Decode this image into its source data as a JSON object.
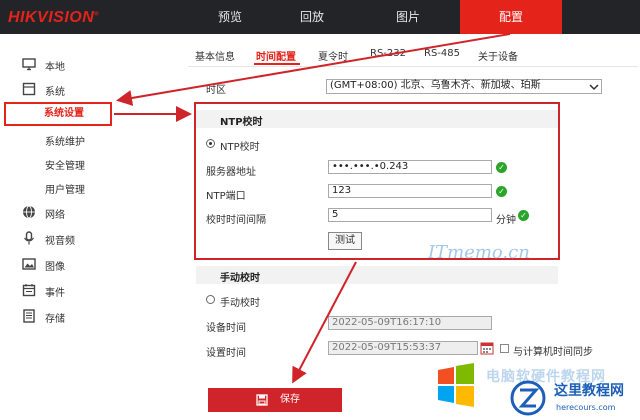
{
  "brand": {
    "logo": "HIKVISION",
    "reg": "®"
  },
  "topnav": [
    {
      "label": "预览"
    },
    {
      "label": "回放"
    },
    {
      "label": "图片"
    },
    {
      "label": "配置"
    }
  ],
  "sidebar": {
    "items": [
      {
        "label": "本地",
        "icon": "monitor-icon"
      },
      {
        "label": "系统",
        "icon": "system-icon"
      },
      {
        "label": "网络",
        "icon": "globe-icon"
      },
      {
        "label": "视音频",
        "icon": "microphone-icon"
      },
      {
        "label": "图像",
        "icon": "image-icon"
      },
      {
        "label": "事件",
        "icon": "calendar-icon"
      },
      {
        "label": "存储",
        "icon": "disk-icon"
      }
    ],
    "system_sub": [
      "系统设置",
      "系统维护",
      "安全管理",
      "用户管理"
    ]
  },
  "tabs": [
    "基本信息",
    "时间配置",
    "夏令时",
    "RS-232",
    "RS-485",
    "关于设备"
  ],
  "timezone": {
    "label": "时区",
    "value": "(GMT+08:00) 北京、乌鲁木齐、新加坡、珀斯"
  },
  "ntp": {
    "title": "NTP校时",
    "radio_label": "NTP校时",
    "server_label": "服务器地址",
    "server_value": "•••.•••.•0.243",
    "port_label": "NTP端口",
    "port_value": "123",
    "interval_label": "校时时间间隔",
    "interval_value": "5",
    "interval_unit": "分钟",
    "test_button": "测试"
  },
  "manual": {
    "title": "手动校时",
    "radio_label": "手动校时",
    "device_time_label": "设备时间",
    "device_time_value": "2022-05-09T16:17:10",
    "set_time_label": "设置时间",
    "set_time_value": "2022-05-09T15:53:37",
    "sync_label": "与计算机时间同步"
  },
  "save_button": "保存",
  "watermark": "ITmemo.cn",
  "footer_brand": {
    "name": "这里教程网",
    "url": "herecours.com",
    "bg_text": "电脑软硬件教程网"
  },
  "colors": {
    "accent": "#e4231b",
    "topbar": "#222427",
    "ok": "#2aa52a",
    "annotation": "#d0242b"
  }
}
